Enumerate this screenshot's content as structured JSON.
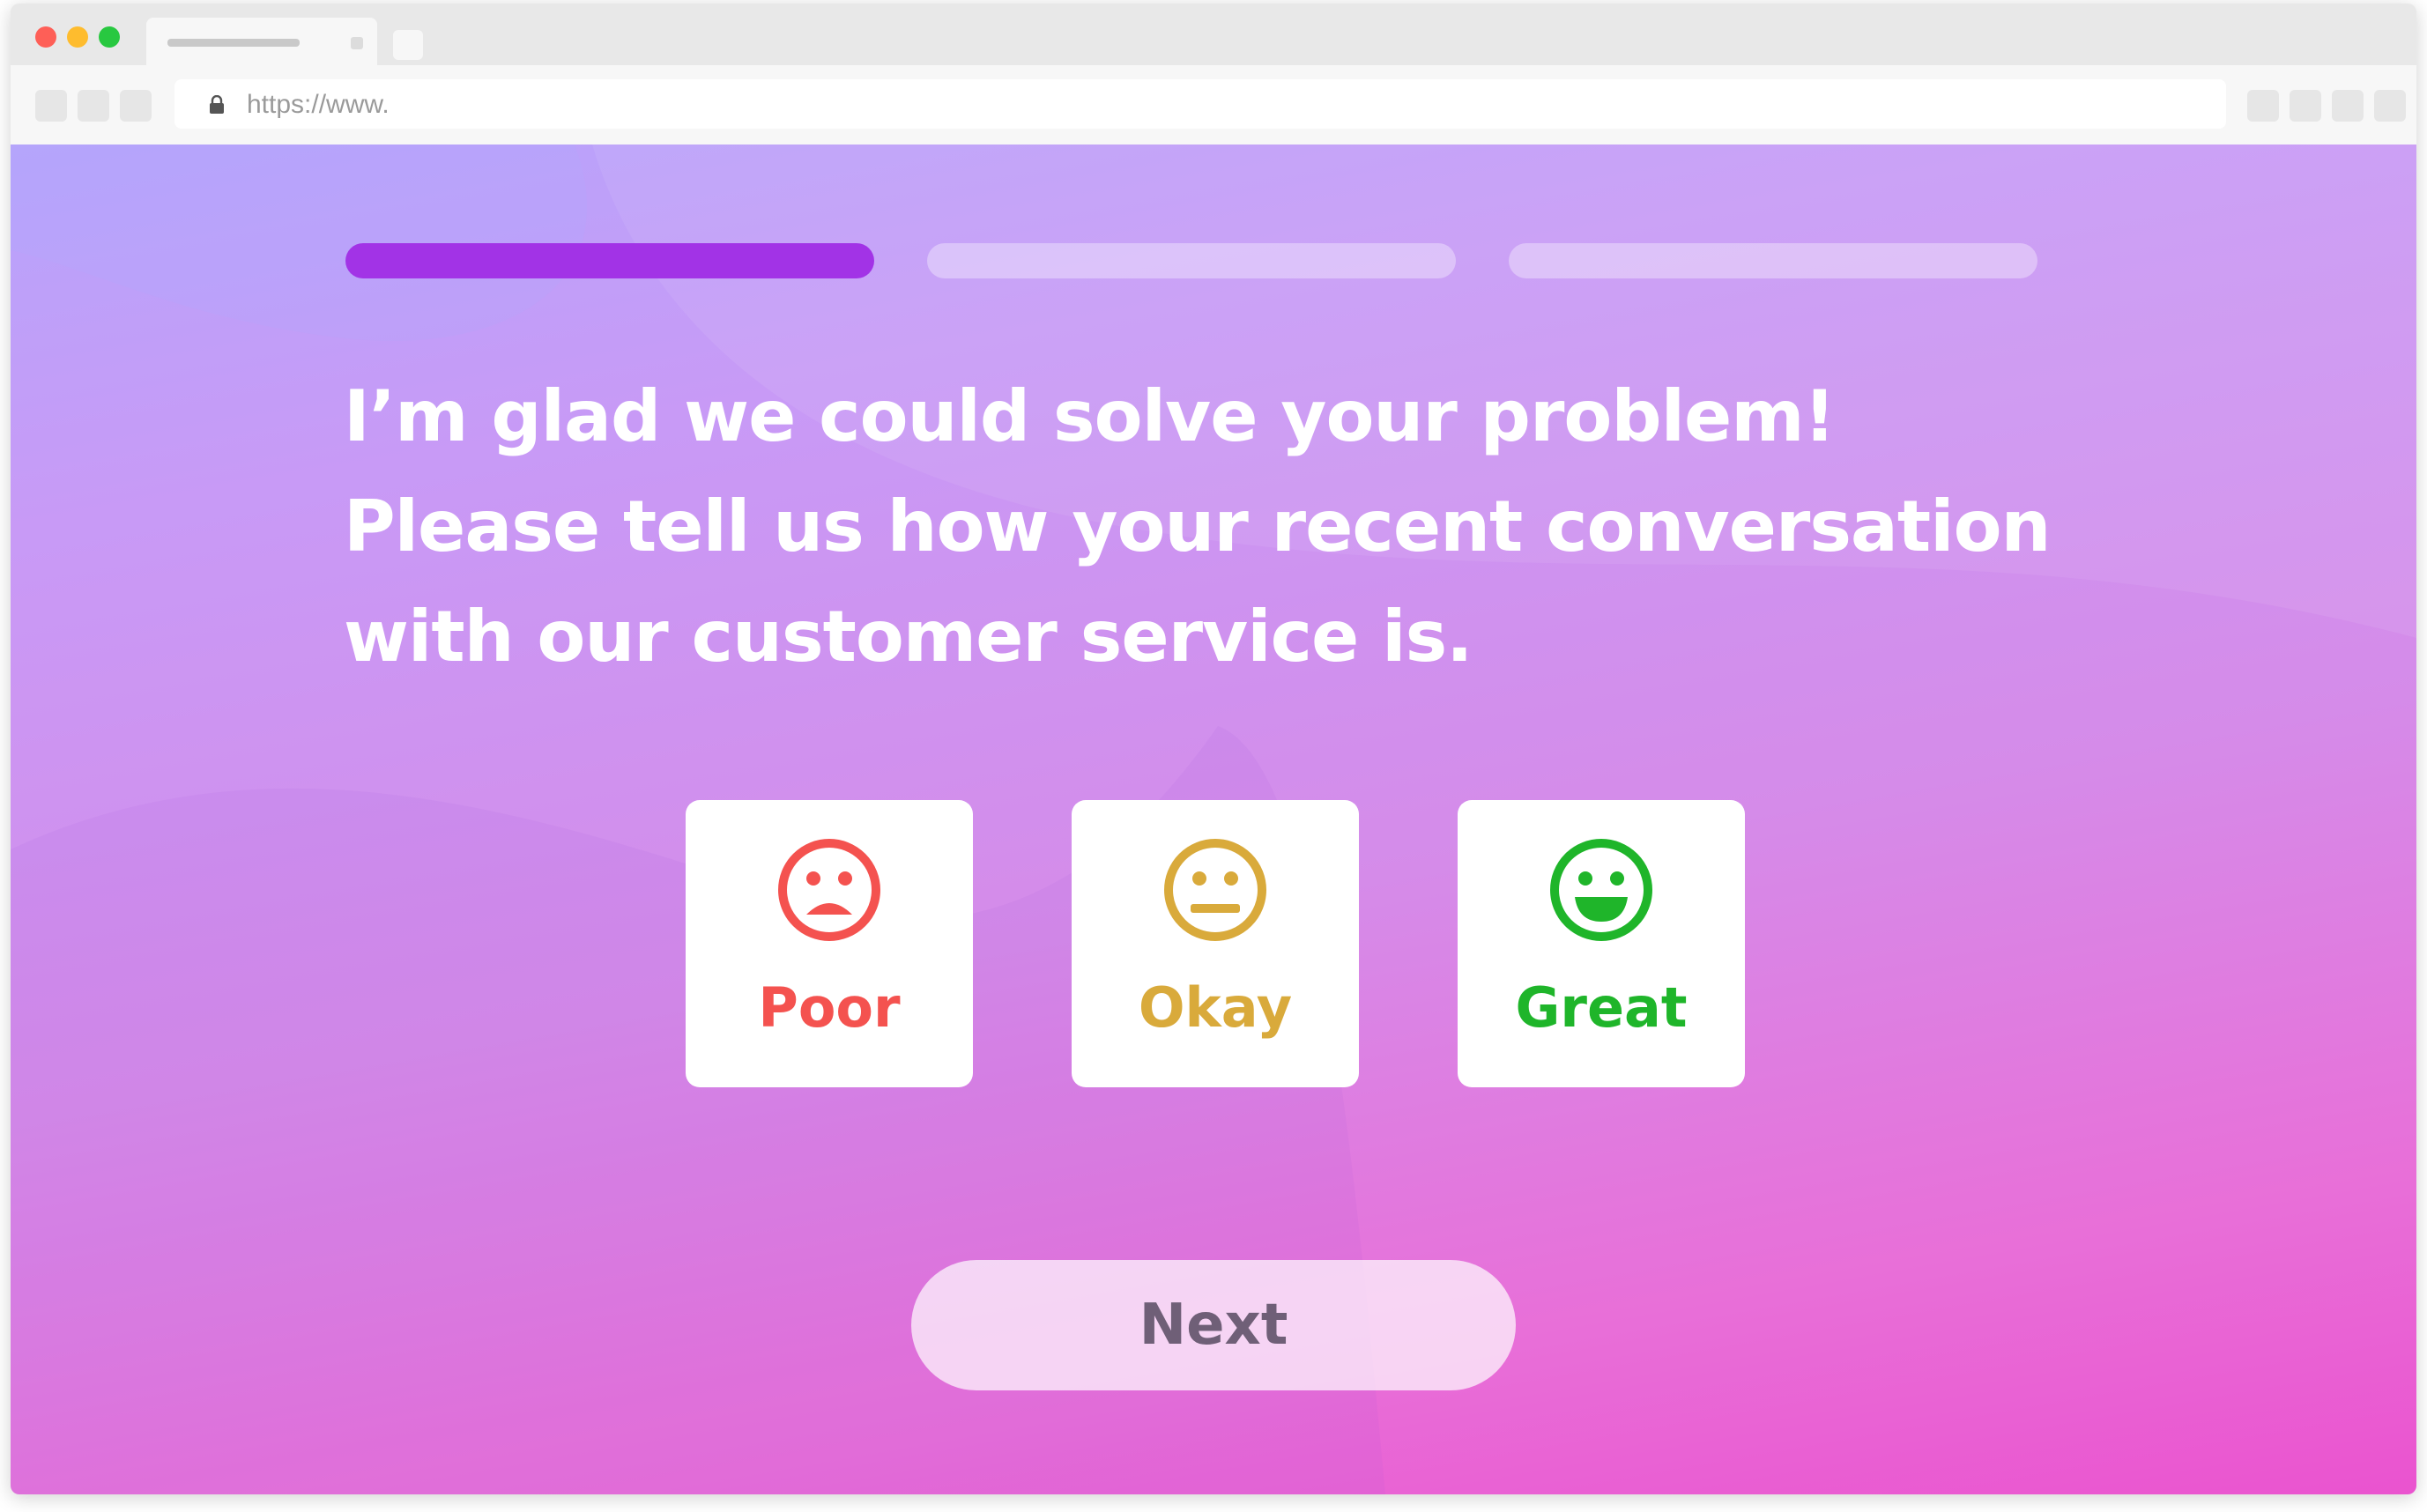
{
  "browser": {
    "url": "https://www."
  },
  "survey": {
    "progress": {
      "total_steps": 3,
      "current_step": 1
    },
    "question": "I’m glad we could solve your problem! Please tell us how your recent conversation with our customer service is.",
    "options": [
      {
        "label": "Poor",
        "icon": "sad-face-icon",
        "color": "#f4524f"
      },
      {
        "label": "Okay",
        "icon": "neutral-face-icon",
        "color": "#d9aa3b"
      },
      {
        "label": "Great",
        "icon": "happy-face-icon",
        "color": "#1fb52a"
      }
    ],
    "next_label": "Next"
  },
  "colors": {
    "progress_active": "#a233e6",
    "gradient_top": "#b7a4fb",
    "gradient_bottom": "#ea53cf"
  }
}
